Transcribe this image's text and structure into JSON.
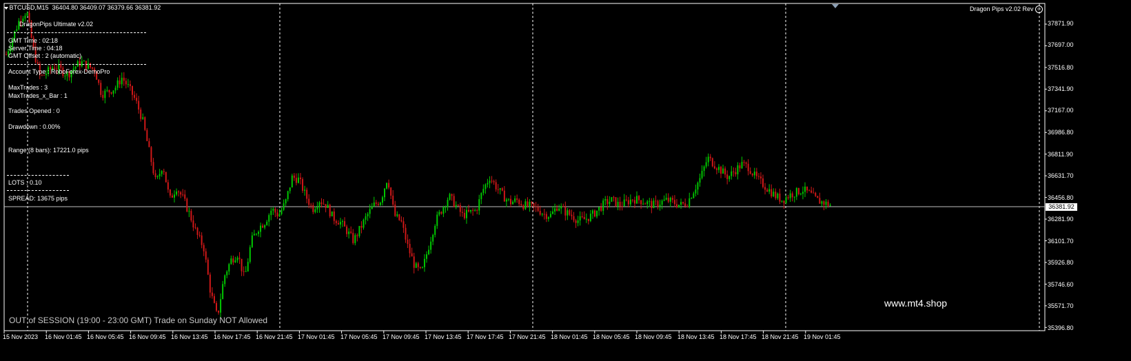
{
  "header": {
    "symbol": "BTCUSD,M15",
    "ohlc": "36404.80 36409.07 36379.66 36381.92",
    "ea_name": "Dragon Pips v2.02 Rev"
  },
  "panel": {
    "title": "DragonPips Ultimate v2.02",
    "gmt_time": "GMT Time   : 02:18",
    "server_time": "Server Time : 04:18",
    "gmt_offset": "GMT Offset  : 2 (automatic)",
    "account_type": "Account Type  :  RoboForex-DemoPro",
    "max_trades": "MaxTrades :  3",
    "max_trades_bar": "MaxTrades_x_Bar :  1",
    "trades_opened": "Trades Opened :  0",
    "drawdown": "Drawdown  :  0.00%",
    "range": "Range (8 bars):  17221.0 pips",
    "lots": "LOTS :  0.10",
    "spread": "SPREAD:  13675  pips"
  },
  "price_axis": [
    "37871.90",
    "37697.00",
    "37516.80",
    "37341.90",
    "37167.00",
    "36986.80",
    "36811.90",
    "36631.70",
    "36456.80",
    "36281.90",
    "36101.70",
    "35926.80",
    "35746.60",
    "35571.70",
    "35396.80"
  ],
  "current_price": "36381.92",
  "time_axis": [
    "15 Nov 2023",
    "16 Nov 01:45",
    "16 Nov 05:45",
    "16 Nov 09:45",
    "16 Nov 13:45",
    "16 Nov 17:45",
    "16 Nov 21:45",
    "17 Nov 01:45",
    "17 Nov 05:45",
    "17 Nov 09:45",
    "17 Nov 13:45",
    "17 Nov 17:45",
    "17 Nov 21:45",
    "18 Nov 01:45",
    "18 Nov 05:45",
    "18 Nov 09:45",
    "18 Nov 13:45",
    "18 Nov 17:45",
    "18 Nov 21:45",
    "19 Nov 01:45"
  ],
  "watermark": "www.mt4.shop",
  "session_message": "OUT of SESSION (19:00 - 23:00 GMT) Trade on Sunday NOT Allowed",
  "colors": {
    "bull": "#00c800",
    "bear": "#d01818",
    "background": "#000000",
    "foreground": "#ffffff"
  },
  "chart_data": {
    "type": "candlestick",
    "symbol": "BTCUSD",
    "timeframe": "M15",
    "ylim": [
      35396.8,
      37960
    ],
    "close_path": [
      37560,
      37700,
      37840,
      37900,
      37600,
      37380,
      37420,
      37470,
      37440,
      37400,
      37460,
      37500,
      37470,
      37440,
      37250,
      37270,
      37300,
      37380,
      37300,
      37200,
      37050,
      36800,
      36550,
      36700,
      36420,
      36520,
      36430,
      36300,
      36150,
      36050,
      35700,
      35500,
      35820,
      35950,
      36000,
      35800,
      36100,
      36200,
      36250,
      36350,
      36300,
      36400,
      36600,
      36580,
      36450,
      36350,
      36420,
      36380,
      36280,
      36250,
      36180,
      36100,
      36200,
      36300,
      36380,
      36420,
      36600,
      36300,
      36250,
      36050,
      35900,
      35850,
      36050,
      36250,
      36350,
      36450,
      36380,
      36300,
      36320,
      36340,
      36500,
      36600,
      36520,
      36450,
      36400,
      36420,
      36380,
      36370,
      36350,
      36310,
      36300,
      36380,
      36330,
      36300,
      36260,
      36270,
      36300,
      36350,
      36400,
      36420,
      36380,
      36400,
      36430,
      36420,
      36400,
      36380,
      36400,
      36420,
      36400,
      36380,
      36400,
      36500,
      36600,
      36750,
      36700,
      36650,
      36600,
      36650,
      36700,
      36680,
      36600,
      36550,
      36500,
      36450,
      36420,
      36460,
      36480,
      36500,
      36470,
      36420,
      36400,
      36382
    ],
    "current_price": 36381.92
  }
}
